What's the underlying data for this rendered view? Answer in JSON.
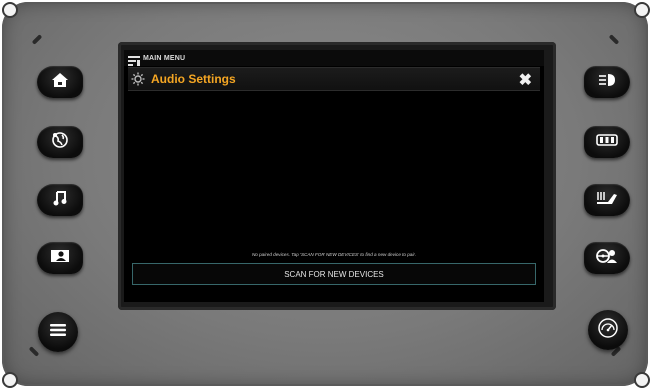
{
  "header": {
    "menu_label": "MAIN MENU",
    "title": "Audio Settings",
    "close_label": "✖"
  },
  "main": {
    "status_message": "No paired devices. Tap 'SCAN FOR NEW DEVICES' to find a new device to pair.",
    "scan_button_label": "SCAN FOR NEW DEVICES"
  },
  "left_buttons": [
    {
      "name": "home",
      "icon": "home-icon"
    },
    {
      "name": "map",
      "icon": "globe-icon"
    },
    {
      "name": "audio",
      "icon": "music-note-icon"
    },
    {
      "name": "user-profile",
      "icon": "user-icon"
    },
    {
      "name": "menu",
      "icon": "hamburger-menu-icon"
    }
  ],
  "right_buttons": [
    {
      "name": "headlights",
      "icon": "headlight-icon"
    },
    {
      "name": "heated-seats",
      "icon": "seat-heat-icon"
    },
    {
      "name": "seat-heat-level",
      "icon": "seat-warmer-icon"
    },
    {
      "name": "steering-profile",
      "icon": "steering-wheel-person-icon"
    },
    {
      "name": "dashboard",
      "icon": "speedometer-icon"
    }
  ],
  "colors": {
    "title_accent": "#f5a623",
    "button_border": "#37676a",
    "bezel": "#7a7a7a",
    "screen_bg": "#000000"
  }
}
